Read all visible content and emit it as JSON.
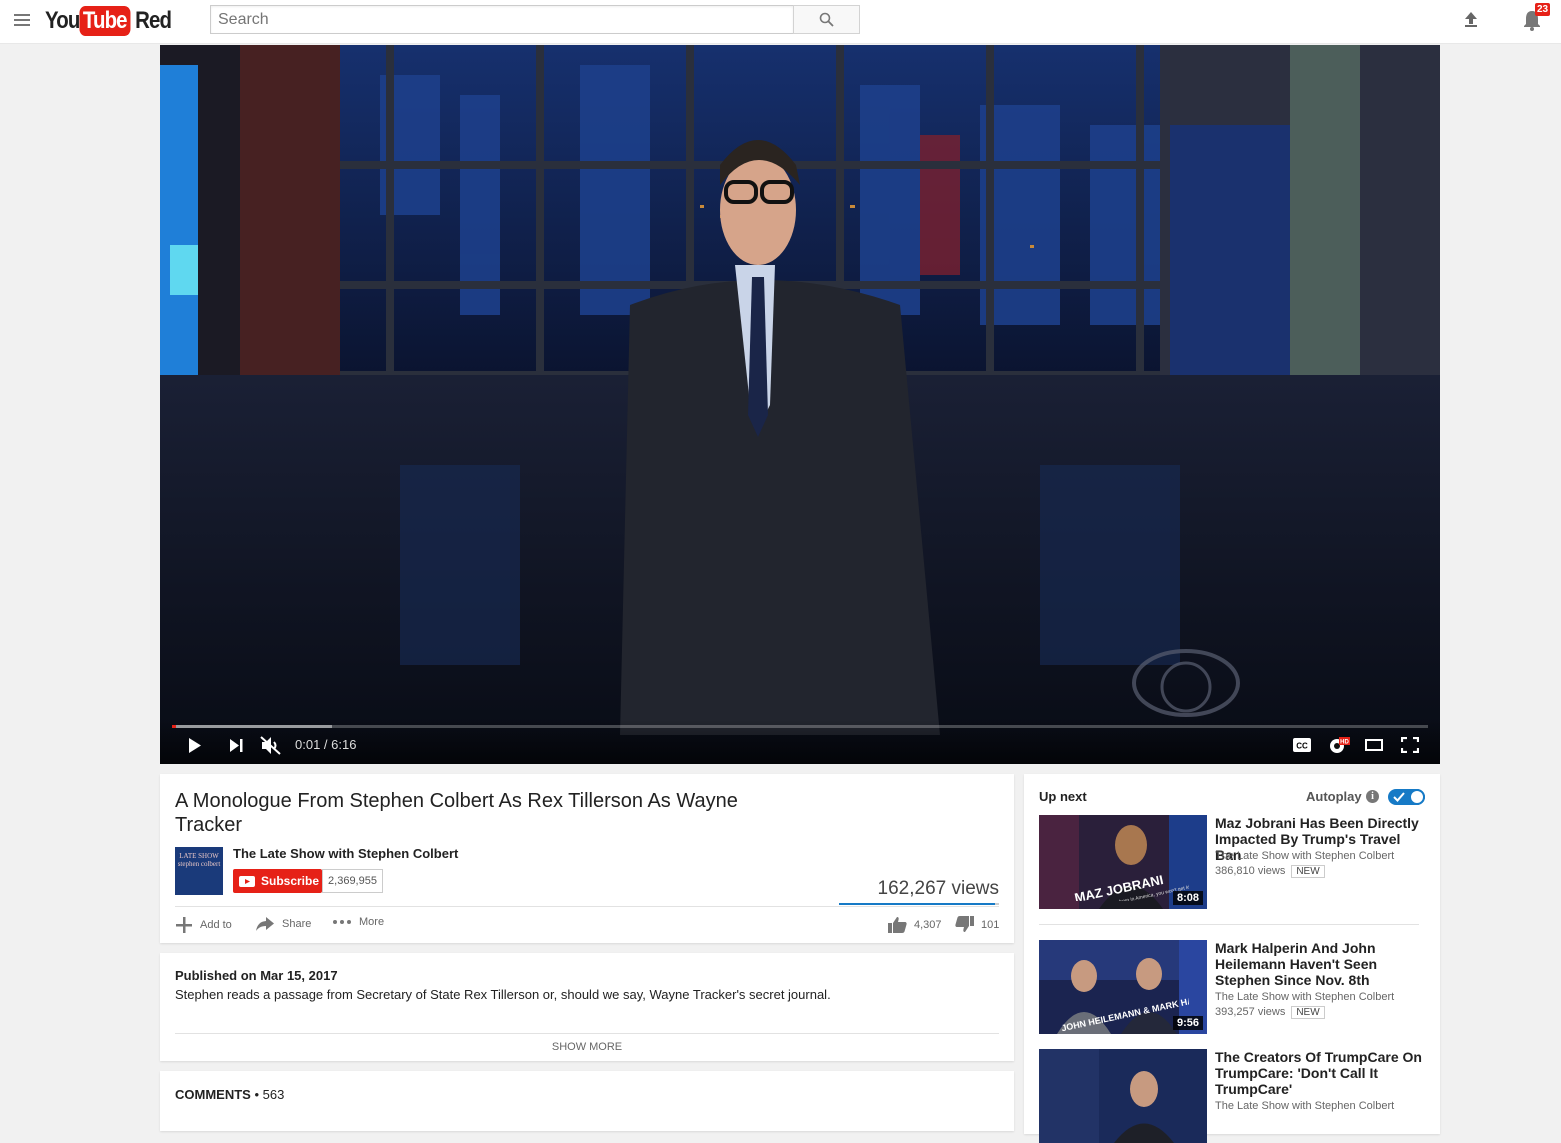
{
  "header": {
    "logo_you": "You",
    "logo_tube": "Tube",
    "logo_red": "Red",
    "search_placeholder": "Search",
    "notification_count": "23"
  },
  "player": {
    "time": "0:01 / 6:16",
    "progress_played": 0.003,
    "progress_loaded": 0.127
  },
  "video": {
    "title": "A Monologue From Stephen Colbert As Rex Tillerson As Wayne Tracker",
    "channel": "The Late Show with Stephen Colbert",
    "channel_thumb_text": "LATE SHOW stephen colbert",
    "subscribe_label": "Subscribe",
    "subscriber_count": "2,369,955",
    "views": "162,267 views",
    "like_ratio": 0.977,
    "likes": "4,307",
    "dislikes": "101",
    "actions": {
      "add_to": "Add to",
      "share": "Share",
      "more": "More"
    },
    "published": "Published on Mar 15, 2017",
    "description": "Stephen reads a passage from Secretary of State Rex Tillerson or, should we say, Wayne Tracker's secret journal.",
    "show_more": "SHOW MORE",
    "comments_label": "COMMENTS",
    "comments_count": "• 563"
  },
  "sidebar": {
    "up_next": "Up next",
    "autoplay": "Autoplay",
    "autoplay_on": true,
    "items": [
      {
        "title": "Maz Jobrani Has Been Directly Impacted By Trump's Travel Ban",
        "channel": "The Late Show with Stephen Colbert",
        "views": "386,810 views",
        "badge": "NEW",
        "duration": "8:08",
        "thumb_text": "MAZ JOBRANI",
        "thumb_sub": "\"If you're born in America, you won't get kicked out...\""
      },
      {
        "title": "Mark Halperin And John Heilemann Haven't Seen Stephen Since Nov. 8th",
        "channel": "The Late Show with Stephen Colbert",
        "views": "393,257 views",
        "badge": "NEW",
        "duration": "9:56",
        "thumb_text": "JOHN HEILEMANN & MARK HALPERIN"
      },
      {
        "title": "The Creators Of TrumpCare On TrumpCare: 'Don't Call It TrumpCare'",
        "channel": "The Late Show with Stephen Colbert",
        "views": "",
        "badge": "",
        "duration": ""
      }
    ]
  },
  "colors": {
    "brand_red": "#e62117",
    "accent_blue": "#167ac6"
  }
}
